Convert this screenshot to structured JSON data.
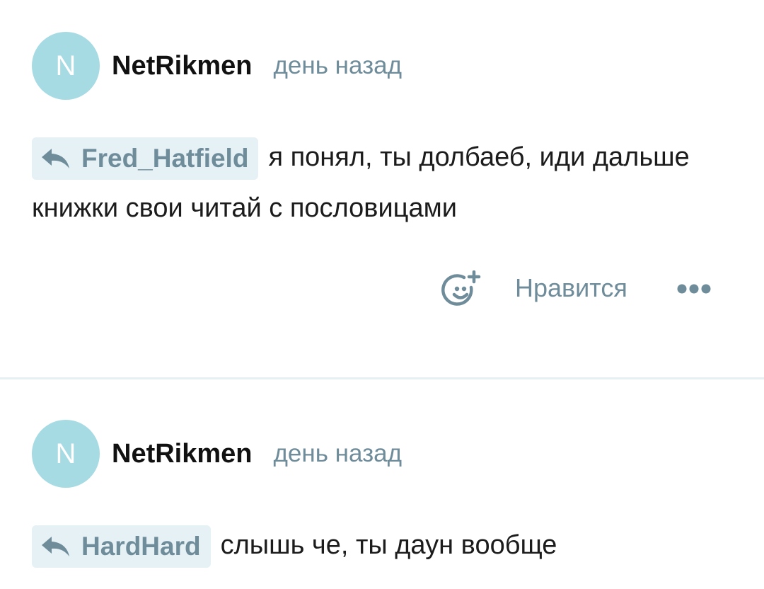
{
  "comments": [
    {
      "avatar_letter": "N",
      "username": "NetRikmen",
      "time": "день назад",
      "reply_to": "Fred_Hatfield",
      "text": "я понял, ты долбаеб, иди дальше книжки свои читай с пословицами",
      "like_label": "Нравится"
    },
    {
      "avatar_letter": "N",
      "username": "NetRikmen",
      "time": "день назад",
      "reply_to": "HardHard",
      "text": "слышь че, ты даун вообще"
    }
  ],
  "icons": {
    "reply": "reply-arrow-icon",
    "react": "add-emoji-icon",
    "more": "more-dots-icon"
  },
  "colors": {
    "avatar_bg": "#a6dbe3",
    "muted": "#6f8c9a",
    "chip_bg": "#e5f1f5"
  }
}
